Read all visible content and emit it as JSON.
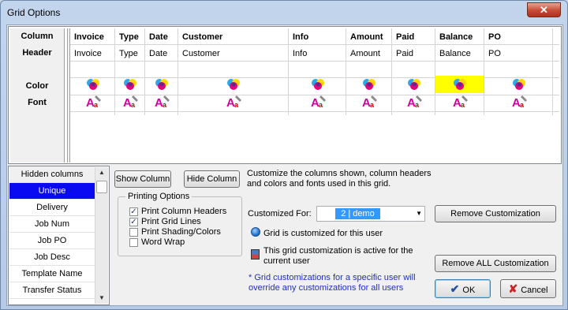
{
  "window": {
    "title": "Grid Options",
    "close_glyph": "✕"
  },
  "grid": {
    "row_headers": {
      "column": "Column",
      "header": "Header",
      "color": "Color",
      "font": "Font"
    },
    "columns": [
      {
        "name": "Invoice",
        "header": "Invoice"
      },
      {
        "name": "Type",
        "header": "Type"
      },
      {
        "name": "Date",
        "header": "Date"
      },
      {
        "name": "Customer",
        "header": "Customer"
      },
      {
        "name": "Info",
        "header": "Info"
      },
      {
        "name": "Amount",
        "header": "Amount"
      },
      {
        "name": "Paid",
        "header": "Paid"
      },
      {
        "name": "Balance",
        "header": "Balance",
        "highlight_color": "#ffff00"
      },
      {
        "name": "PO",
        "header": "PO"
      }
    ]
  },
  "hidden_columns": {
    "title": "Hidden columns",
    "items": [
      "Unique",
      "Delivery",
      "Job Num",
      "Job PO",
      "Job Desc",
      "Template Name",
      "Transfer Status"
    ],
    "selected": "Unique"
  },
  "buttons": {
    "show_column": "Show Column",
    "hide_column": "Hide Column",
    "remove_customization": "Remove Customization",
    "remove_all_customization": "Remove ALL Customization",
    "ok": "OK",
    "cancel": "Cancel"
  },
  "description": "Customize the columns shown, column headers and colors and fonts used in this grid.",
  "printing_options": {
    "title": "Printing Options",
    "items": [
      {
        "label": "Print Column Headers",
        "checked": true
      },
      {
        "label": "Print Grid Lines",
        "checked": true
      },
      {
        "label": "Print Shading/Colors",
        "checked": false
      },
      {
        "label": "Word Wrap",
        "checked": false
      }
    ]
  },
  "customized_for": {
    "label": "Customized For:",
    "value": "2 | demo"
  },
  "status": {
    "customized": "Grid is customized for this user",
    "active": "This grid customization is active for the current user"
  },
  "footnote": "* Grid customizations for a specific user will override any customizations for all users",
  "colors": {
    "selected_blue": "#0a0af2",
    "accent": "#1f2fbf"
  }
}
